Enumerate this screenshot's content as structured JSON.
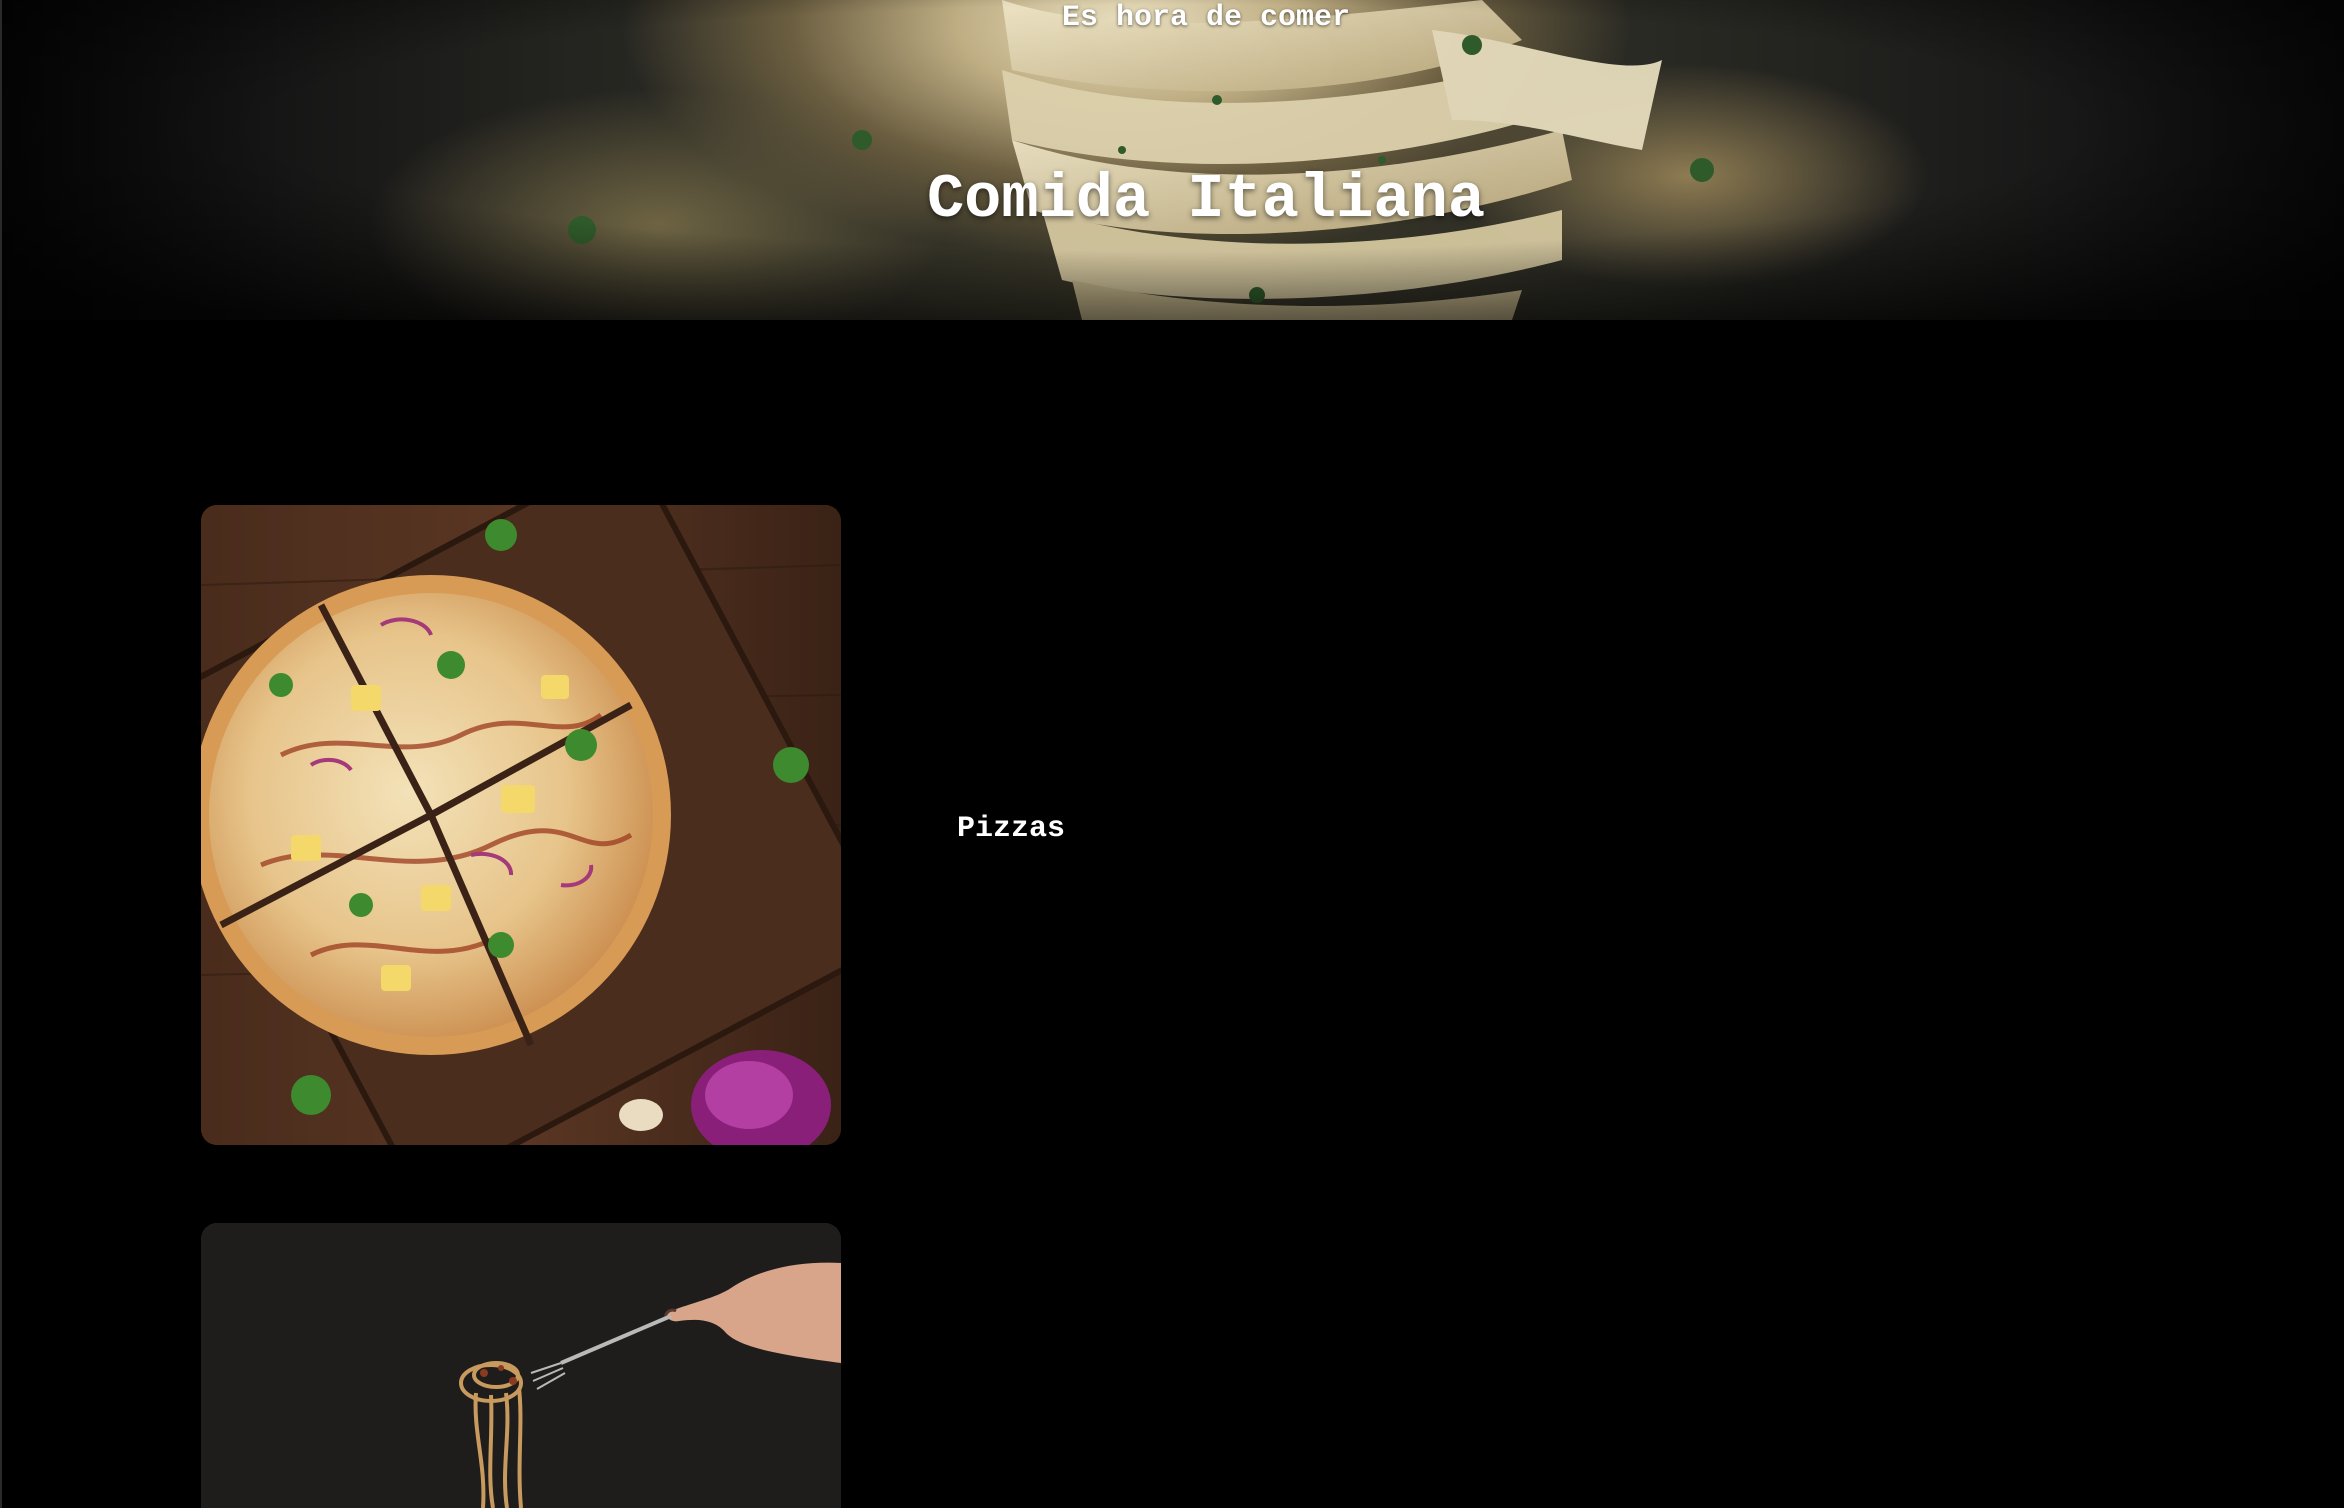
{
  "hero": {
    "eyebrow": "Es hora de comer",
    "title": "Comida Italiana"
  },
  "menu": {
    "items": [
      {
        "label": "Pizzas",
        "image": "pizza-photo"
      },
      {
        "label": "",
        "image": "pasta-photo"
      }
    ]
  },
  "colors": {
    "background": "#000000",
    "text": "#ffffff"
  }
}
